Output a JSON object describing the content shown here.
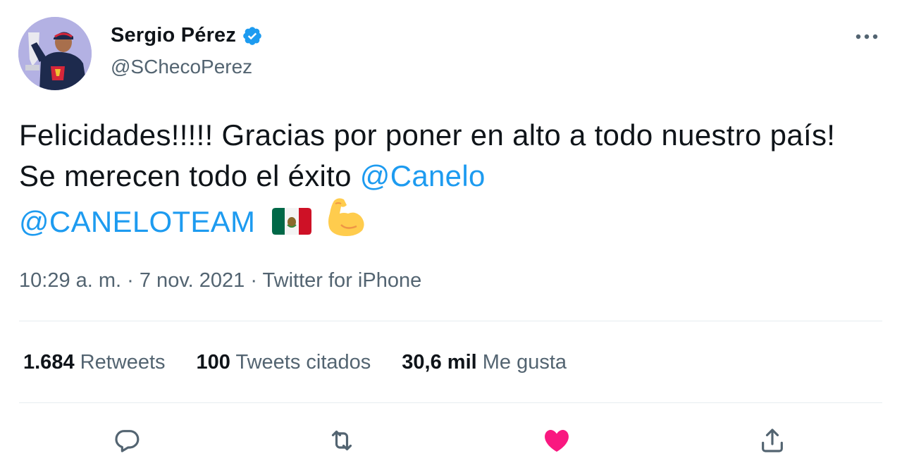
{
  "author": {
    "display_name": "Sergio Pérez",
    "handle": "@SChecoPerez",
    "verified": true
  },
  "tweet": {
    "text_part1": "Felicidades!!!!! Gracias por poner en alto a todo nuestro país! Se merecen todo el éxito ",
    "mention1": "@Canelo",
    "mention2": "@CANELOTEAM",
    "emojis": [
      "flag-mexico",
      "flexed-biceps"
    ]
  },
  "meta": {
    "time": "10:29 a. m.",
    "sep": " · ",
    "date": "7 nov. 2021",
    "source": "Twitter for iPhone"
  },
  "stats": {
    "retweets_count": "1.684",
    "retweets_label": "Retweets",
    "quotes_count": "100",
    "quotes_label": "Tweets citados",
    "likes_count": "30,6 mil",
    "likes_label": "Me gusta"
  },
  "actions": {
    "icons": [
      "reply-icon",
      "retweet-icon",
      "like-icon",
      "share-icon"
    ],
    "liked": true
  },
  "colors": {
    "mention": "#1d9bf0",
    "verified": "#1d9bf0",
    "like": "#f91880",
    "secondary_text": "#536471",
    "divider": "#e6ecf0"
  }
}
